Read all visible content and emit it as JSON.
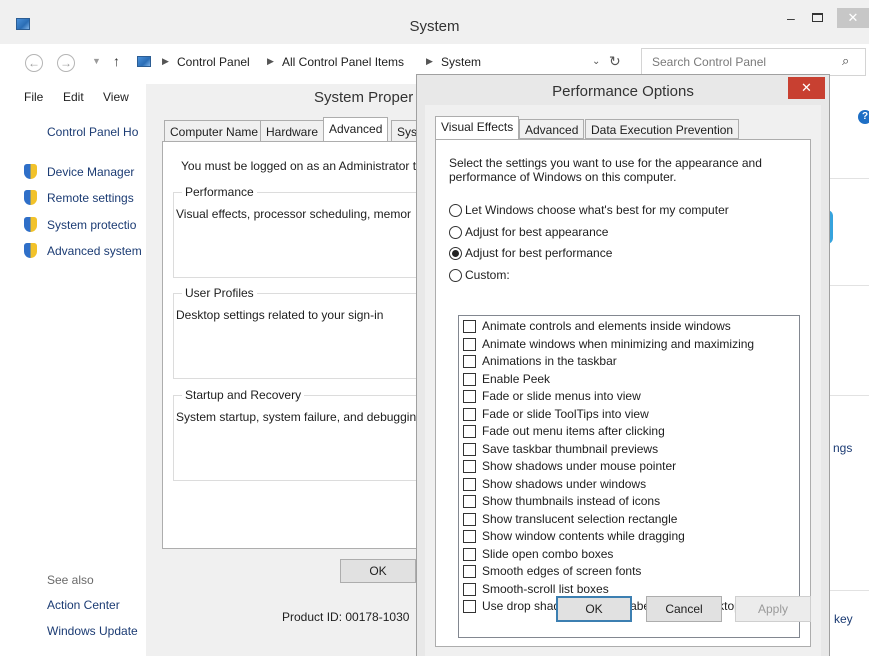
{
  "window": {
    "title": "System",
    "minimize": "–",
    "close": "✕"
  },
  "address": {
    "crumbs": [
      "Control Panel",
      "All Control Panel Items",
      "System"
    ],
    "search_placeholder": "Search Control Panel"
  },
  "menu": [
    "File",
    "Edit",
    "View"
  ],
  "left_pane": {
    "home": "Control Panel Ho",
    "links": [
      "Device Manager",
      "Remote settings",
      "System protectio",
      "Advanced system"
    ],
    "see_also": "See also",
    "see_also_links": [
      "Action Center",
      "Windows Update"
    ]
  },
  "right_fragments": {
    "settings": "ngs",
    "key": "key"
  },
  "system_properties": {
    "title": "System Proper",
    "tabs": [
      "Computer Name",
      "Hardware",
      "Advanced",
      "Sys"
    ],
    "admin_note": "You must be logged on as an Administrator to",
    "performance_label": "Performance",
    "performance_desc": "Visual effects, processor scheduling, memor",
    "profiles_label": "User Profiles",
    "profiles_desc": "Desktop settings related to your sign-in",
    "startup_label": "Startup and Recovery",
    "startup_desc": "System startup, system failure, and debuggin",
    "ok": "OK",
    "product_id": "Product ID: 00178-1030"
  },
  "performance_options": {
    "title": "Performance Options",
    "close": "✕",
    "tabs": [
      "Visual Effects",
      "Advanced",
      "Data Execution Prevention"
    ],
    "intro": "Select the settings you want to use for the appearance and performance of Windows on this computer.",
    "radios": [
      {
        "label": "Let Windows choose what's best for my computer",
        "selected": false
      },
      {
        "label": "Adjust for best appearance",
        "selected": false
      },
      {
        "label": "Adjust for best performance",
        "selected": true
      },
      {
        "label": "Custom:",
        "selected": false
      }
    ],
    "checkboxes": [
      "Animate controls and elements inside windows",
      "Animate windows when minimizing and maximizing",
      "Animations in the taskbar",
      "Enable Peek",
      "Fade or slide menus into view",
      "Fade or slide ToolTips into view",
      "Fade out menu items after clicking",
      "Save taskbar thumbnail previews",
      "Show shadows under mouse pointer",
      "Show shadows under windows",
      "Show thumbnails instead of icons",
      "Show translucent selection rectangle",
      "Show window contents while dragging",
      "Slide open combo boxes",
      "Smooth edges of screen fonts",
      "Smooth-scroll list boxes",
      "Use drop shadows for icon labels on the desktop"
    ],
    "buttons": {
      "ok": "OK",
      "cancel": "Cancel",
      "apply": "Apply"
    }
  }
}
